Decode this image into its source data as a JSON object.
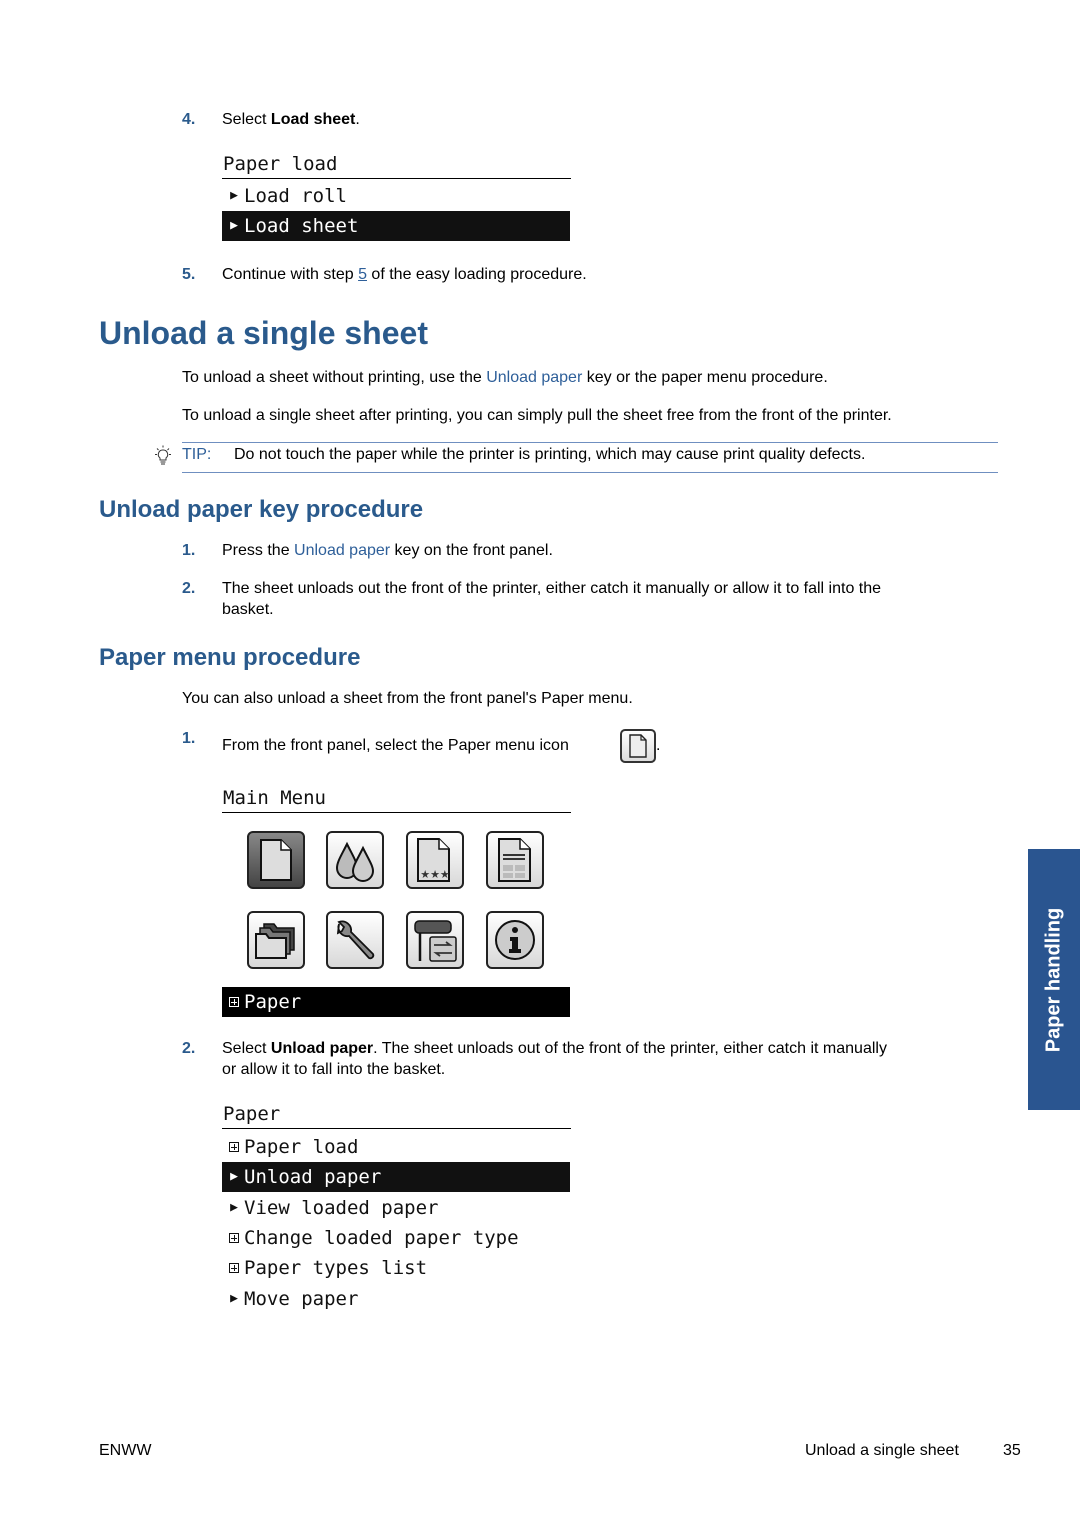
{
  "step4": {
    "number": "4.",
    "prefix": "Select ",
    "bold": "Load sheet",
    "suffix": "."
  },
  "paper_load_panel": {
    "title": "Paper load",
    "items": [
      {
        "marker": "arrow",
        "label": "Load roll",
        "selected": false
      },
      {
        "marker": "arrow",
        "label": "Load sheet",
        "selected": true
      }
    ]
  },
  "step5": {
    "number": "5.",
    "prefix": "Continue with step ",
    "link": "5",
    "suffix": " of the easy loading procedure."
  },
  "section": {
    "title": "Unload a single sheet",
    "para1_prefix": "To unload a sheet without printing, use the ",
    "para1_link": "Unload paper",
    "para1_suffix": " key or the paper menu procedure.",
    "para2": "To unload a single sheet after printing, you can simply pull the sheet free from the front of the printer.",
    "tip_label": "TIP:",
    "tip_text": "Do not touch the paper while the printer is printing, which may cause print quality defects."
  },
  "unload_key": {
    "title": "Unload paper key procedure",
    "steps": [
      {
        "number": "1.",
        "prefix": "Press the ",
        "link": "Unload paper",
        "suffix": " key on the front panel."
      },
      {
        "number": "2.",
        "line1": "The sheet unloads out the front of the printer, either catch it manually or allow it to fall into the",
        "line2": "basket."
      }
    ]
  },
  "paper_menu": {
    "title": "Paper menu procedure",
    "intro": "You can also unload a sheet from the front panel's Paper menu.",
    "step1": {
      "number": "1.",
      "text": "From the front panel, select the Paper menu icon",
      "suffix": "."
    },
    "main_menu": {
      "title": "Main Menu",
      "icons": [
        "paper-icon",
        "ink-drops-icon",
        "print-quality-icon",
        "job-document-icon",
        "job-queue-folder-icon",
        "setup-wrench-icon",
        "connectivity-icon",
        "information-icon"
      ],
      "selected_label": "Paper"
    },
    "step2": {
      "number": "2.",
      "prefix": "Select ",
      "bold": "Unload paper",
      "line1_suffix": ". The sheet unloads out of the front of the printer, either catch it manually",
      "line2": "or allow it to fall into the basket."
    },
    "paper_panel": {
      "title": "Paper",
      "items": [
        {
          "marker": "plus",
          "label": "Paper load",
          "selected": false
        },
        {
          "marker": "arrow",
          "label": "Unload paper",
          "selected": true
        },
        {
          "marker": "arrow",
          "label": "View loaded paper",
          "selected": false
        },
        {
          "marker": "plus",
          "label": "Change loaded paper type",
          "selected": false
        },
        {
          "marker": "plus",
          "label": "Paper types list",
          "selected": false
        },
        {
          "marker": "arrow",
          "label": "Move paper",
          "selected": false
        }
      ]
    }
  },
  "side_tab": "Paper handling",
  "footer": {
    "left": "ENWW",
    "section": "Unload a single sheet",
    "page": "35"
  }
}
